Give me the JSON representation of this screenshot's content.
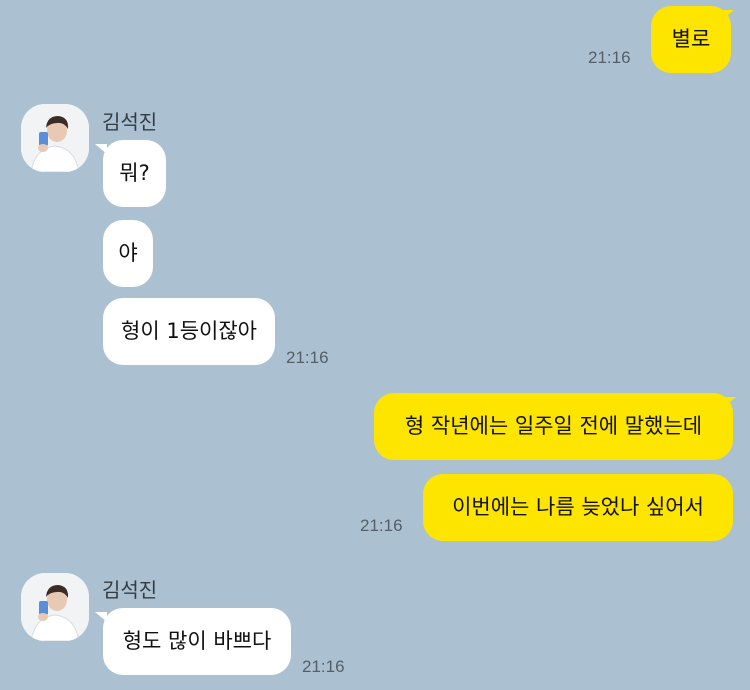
{
  "contact": {
    "name": "김석진"
  },
  "colors": {
    "background": "#abc1d1",
    "outgoing_bubble": "#fde500",
    "incoming_bubble": "#ffffff"
  },
  "messages": [
    {
      "direction": "outgoing",
      "text": "별로",
      "time": "21:16"
    },
    {
      "direction": "incoming",
      "text": "뭐?"
    },
    {
      "direction": "incoming",
      "text": "야"
    },
    {
      "direction": "incoming",
      "text": "형이 1등이잖아",
      "time": "21:16"
    },
    {
      "direction": "outgoing",
      "text": "형 작년에는 일주일 전에 말했는데"
    },
    {
      "direction": "outgoing",
      "text": "이번에는 나름 늦었나 싶어서",
      "time": "21:16"
    },
    {
      "direction": "incoming",
      "text": "형도 많이 바쁘다",
      "time": "21:16"
    }
  ]
}
